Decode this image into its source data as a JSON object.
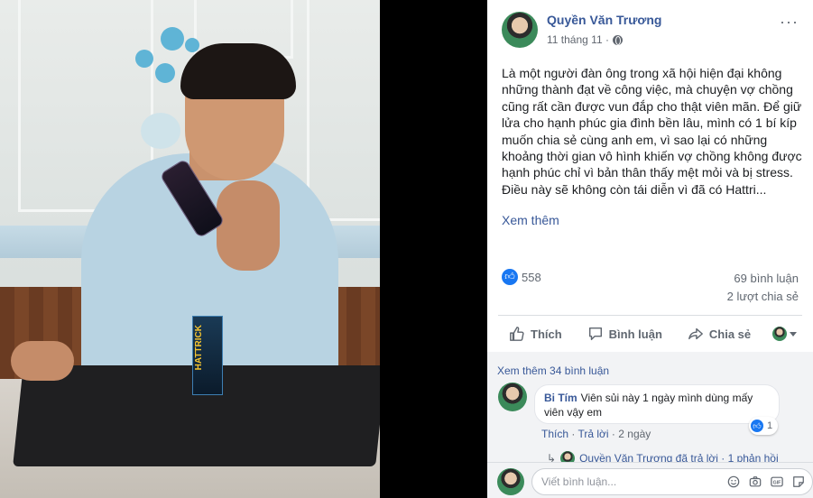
{
  "post": {
    "author": "Quyền Văn Trương",
    "time": "11 tháng 11 ·",
    "text": "Là một người đàn ông trong xã hội hiện đại không những thành đạt về công việc, mà chuyện vợ chồng cũng rất cần được vun đắp cho thật viên mãn. Để giữ lửa cho hạnh phúc gia đình bền lâu, mình có 1 bí kíp muốn chia sẻ cùng anh em, vì sao lại có những khoảng thời gian vô hình khiến vợ chồng không được hạnh phúc chỉ vì bản thân thấy mệt mỏi và bị stress.\nĐiều này sẽ không còn tái diễn vì đã có Hattri...",
    "see_more": "Xem thêm",
    "more_icon": "···"
  },
  "stats": {
    "likes": "558",
    "comments": "69 bình luận",
    "shares": "2 lượt chia sẻ"
  },
  "actions": {
    "like": "Thích",
    "comment": "Bình luận",
    "share": "Chia sẻ"
  },
  "comments": {
    "view_more": "Xem thêm 34 bình luận",
    "items": [
      {
        "name": "Bi Tím",
        "text": "Viên sủi này 1 ngày mình dùng mấy viên vậy em",
        "reactions": "1",
        "like_label": "Thích",
        "reply_label": "Trả lời",
        "time": "2 ngày"
      }
    ],
    "reply_line": "Quyền Văn Trương đã trả lời · 1 phản hồi"
  },
  "input": {
    "placeholder": "Viết bình luận..."
  },
  "photo": {
    "product_text": "HATTRICK"
  },
  "colors": {
    "link": "#385898",
    "like_blue": "#1877f2",
    "muted": "#606770"
  }
}
